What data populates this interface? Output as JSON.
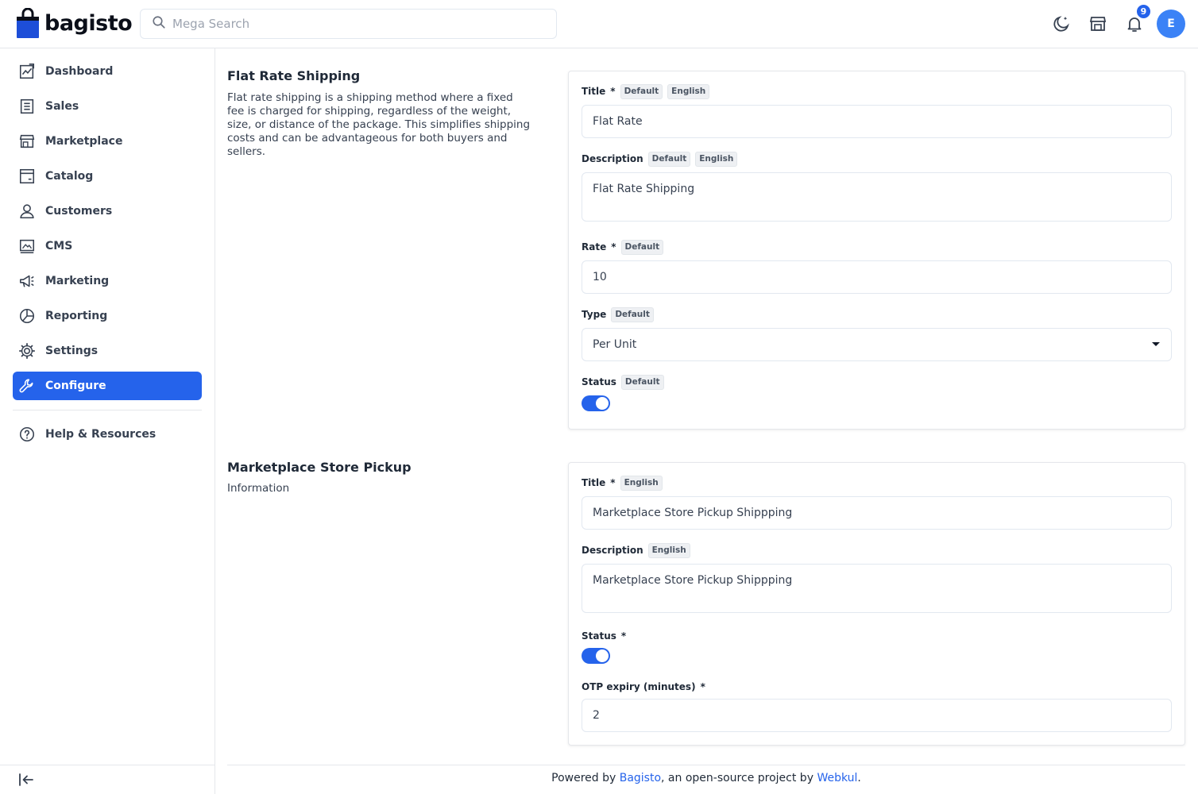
{
  "header": {
    "logo_text": "bagisto",
    "search_placeholder": "Mega Search",
    "notification_count": "9",
    "avatar_initial": "E"
  },
  "sidebar": {
    "items": [
      {
        "label": "Dashboard",
        "icon": "dashboard-icon"
      },
      {
        "label": "Sales",
        "icon": "sales-icon"
      },
      {
        "label": "Marketplace",
        "icon": "store-icon"
      },
      {
        "label": "Catalog",
        "icon": "catalog-icon"
      },
      {
        "label": "Customers",
        "icon": "user-icon"
      },
      {
        "label": "CMS",
        "icon": "cms-icon"
      },
      {
        "label": "Marketing",
        "icon": "megaphone-icon"
      },
      {
        "label": "Reporting",
        "icon": "pie-chart-icon"
      },
      {
        "label": "Settings",
        "icon": "gear-icon"
      },
      {
        "label": "Configure",
        "icon": "wrench-icon",
        "active": true
      }
    ],
    "help_label": "Help & Resources"
  },
  "flat_rate": {
    "title": "Flat Rate Shipping",
    "description": "Flat rate shipping is a shipping method where a fixed fee is charged for shipping, regardless of the weight, size, or distance of the package. This simplifies shipping costs and can be advantageous for both buyers and sellers.",
    "title_label": "Title",
    "title_value": "Flat Rate",
    "description_label": "Description",
    "description_value": "Flat Rate Shipping",
    "rate_label": "Rate",
    "rate_value": "10",
    "type_label": "Type",
    "type_value": "Per Unit",
    "status_label": "Status",
    "status_on": true
  },
  "store_pickup": {
    "title": "Marketplace Store Pickup",
    "description": "Information",
    "title_label": "Title",
    "title_value": "Marketplace Store Pickup Shippping",
    "description_label": "Description",
    "description_value": "Marketplace Store Pickup Shippping",
    "status_label": "Status",
    "status_on": true,
    "otp_label": "OTP expiry (minutes)",
    "otp_value": "2"
  },
  "chips": {
    "default": "Default",
    "english": "English",
    "required_mark": "*"
  },
  "footer": {
    "prefix": "Powered by ",
    "bagisto_link": "Bagisto",
    "middle": ", an open-source project by ",
    "webkul_link": "Webkul",
    "suffix": "."
  },
  "colors": {
    "accent": "#2563eb",
    "border": "#e5e7eb"
  }
}
